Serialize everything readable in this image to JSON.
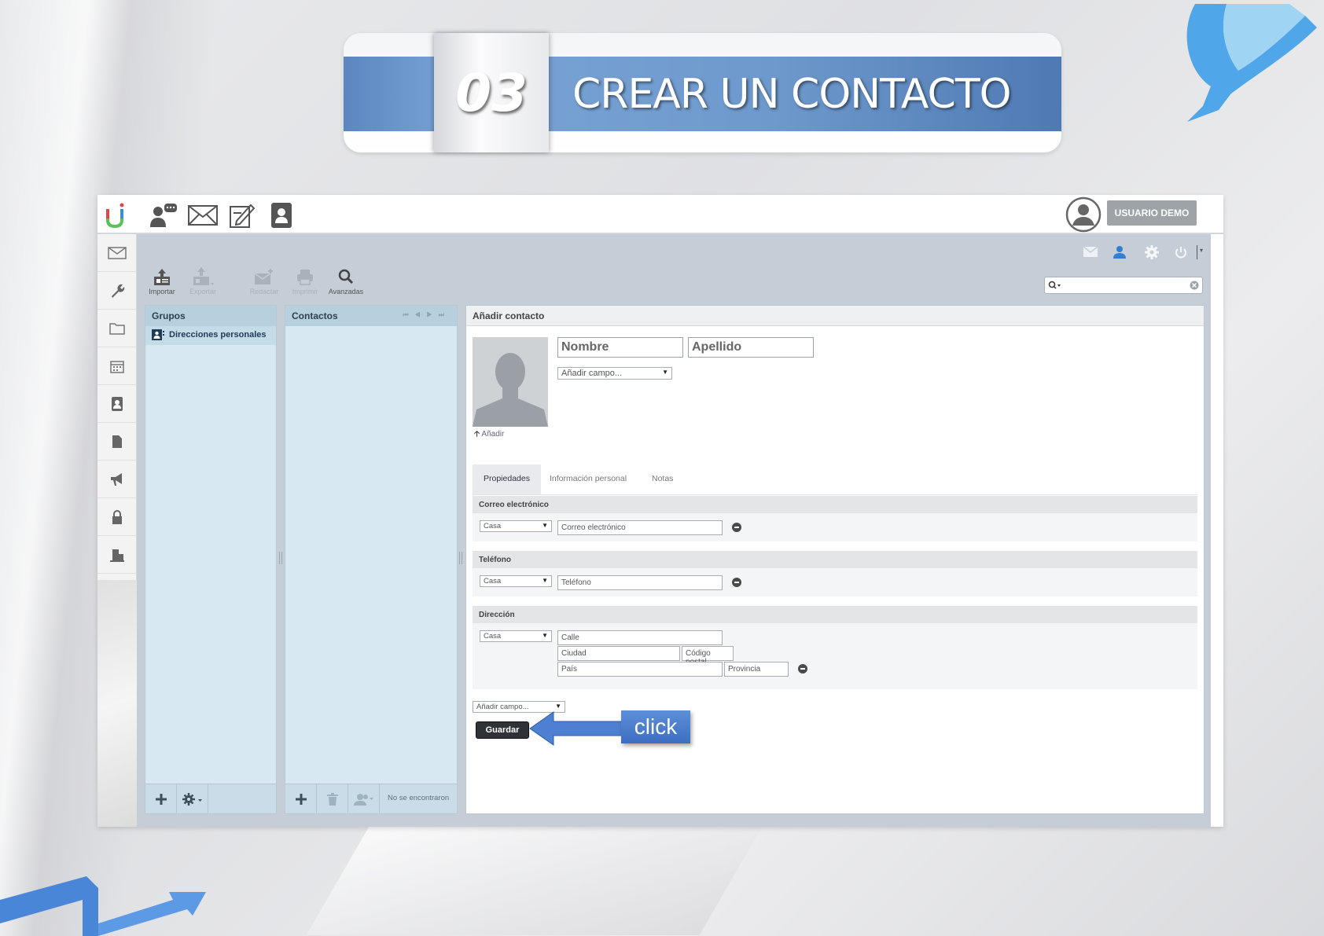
{
  "banner": {
    "number": "03",
    "title": "CREAR UN CONTACTO"
  },
  "app": {
    "user_label": "USUARIO DEMO",
    "top_icons": [
      "chat-icon",
      "mail-icon",
      "compose-icon",
      "contacts-icon"
    ],
    "left_nav": [
      "mail-icon",
      "wrench-icon",
      "folder-icon",
      "calendar-icon",
      "contacts-icon",
      "file-icon",
      "megaphone-icon",
      "lock-icon",
      "building-icon"
    ],
    "toolbar": [
      {
        "label": "Importar",
        "enabled": true
      },
      {
        "label": "Exportar",
        "enabled": false
      },
      {
        "label": "Redactar",
        "enabled": false
      },
      {
        "label": "Imprimir",
        "enabled": false
      },
      {
        "label": "Avanzadas",
        "enabled": true
      }
    ],
    "search_placeholder": ""
  },
  "groups_panel": {
    "title": "Grupos",
    "items": [
      "Direcciones personales"
    ]
  },
  "contacts_panel": {
    "title": "Contactos",
    "footer_text": "No se encontraron"
  },
  "form": {
    "title": "Añadir contacto",
    "first_name_placeholder": "Nombre",
    "last_name_placeholder": "Apellido",
    "add_field_label": "Añadir campo...",
    "add_photo_label": "Añadir",
    "tabs": [
      "Propiedades",
      "Información personal",
      "Notas"
    ],
    "email_section": {
      "title": "Correo electrónico",
      "type": "Casa",
      "placeholder": "Correo electrónico"
    },
    "phone_section": {
      "title": "Teléfono",
      "type": "Casa",
      "placeholder": "Teléfono"
    },
    "address_section": {
      "title": "Dirección",
      "type": "Casa",
      "street": "Calle",
      "city": "Ciudad",
      "postal": "Código postal",
      "country": "País",
      "province": "Provincia"
    },
    "bottom_add_field": "Añadir campo...",
    "save_label": "Guardar"
  },
  "annotation": {
    "click_label": "click"
  },
  "colors": {
    "accent_blue": "#4f79b3",
    "panel_blue": "#d8e8f2",
    "panel_head": "#b7d0de"
  }
}
